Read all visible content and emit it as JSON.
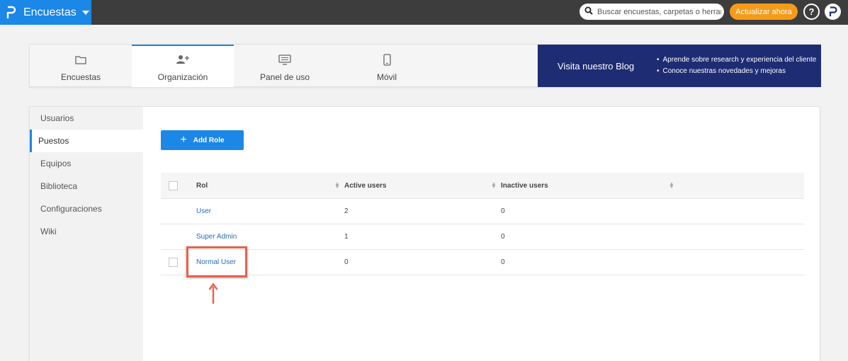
{
  "topbar": {
    "app_title": "Encuestas",
    "search_placeholder": "Buscar encuestas, carpetas o herramientas",
    "upgrade_label": "Actualizar ahora",
    "help_label": "?"
  },
  "tabs": [
    {
      "label": "Encuestas",
      "icon": "folder-icon"
    },
    {
      "label": "Organización",
      "icon": "user-add-icon"
    },
    {
      "label": "Panel de uso",
      "icon": "monitor-icon"
    },
    {
      "label": "Móvil",
      "icon": "mobile-icon"
    }
  ],
  "blog": {
    "title": "Visita nuestro Blog",
    "bullets": [
      "Aprende sobre research y experiencia del cliente",
      "Conoce nuestras novedades y mejoras"
    ]
  },
  "sidebar": {
    "items": [
      {
        "label": "Usuarios"
      },
      {
        "label": "Puestos"
      },
      {
        "label": "Equipos"
      },
      {
        "label": "Biblioteca"
      },
      {
        "label": "Configuraciones"
      },
      {
        "label": "Wiki"
      }
    ]
  },
  "main": {
    "add_role_label": "Add Role",
    "columns": {
      "role": "Rol",
      "active": "Active users",
      "inactive": "Inactive users"
    },
    "rows": [
      {
        "role": "User",
        "active": "2",
        "inactive": "0"
      },
      {
        "role": "Super Admin",
        "active": "1",
        "inactive": "0"
      },
      {
        "role": "Normal User",
        "active": "0",
        "inactive": "0"
      }
    ]
  },
  "colors": {
    "brand": "#1b87e6",
    "topbar": "#3d3d3d",
    "upgrade": "#f49c1a",
    "blog": "#1d2c73",
    "highlight": "#e8604c"
  }
}
